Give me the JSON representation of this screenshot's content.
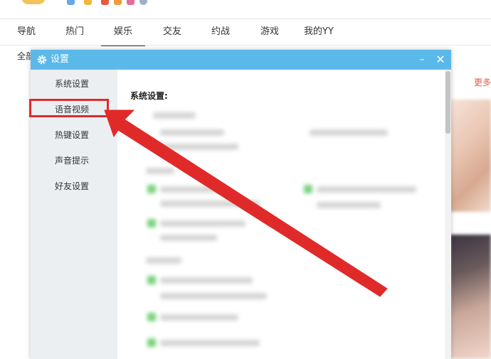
{
  "nav": {
    "tabs": [
      {
        "label": "导航"
      },
      {
        "label": "热门"
      },
      {
        "label": "娱乐"
      },
      {
        "label": "交友"
      },
      {
        "label": "约战"
      },
      {
        "label": "游戏"
      },
      {
        "label": "我的YY"
      }
    ],
    "active_index": 2
  },
  "page": {
    "all_label_cropped": "全部",
    "more_label_cropped": "更多"
  },
  "dialog": {
    "title": "设置",
    "minimize_glyph": "–",
    "close_glyph": "✕",
    "sidebar": [
      {
        "label": "系统设置"
      },
      {
        "label": "语音视频"
      },
      {
        "label": "热键设置"
      },
      {
        "label": "声音提示"
      },
      {
        "label": "好友设置"
      }
    ],
    "highlighted_item": "语音视频",
    "content_heading": "系统设置:"
  },
  "colors": {
    "titlebar": "#5bb9ea",
    "sidebar_bg": "#ebeff2",
    "annotation_red": "#e02a2a",
    "more_link": "#e05a4a"
  }
}
